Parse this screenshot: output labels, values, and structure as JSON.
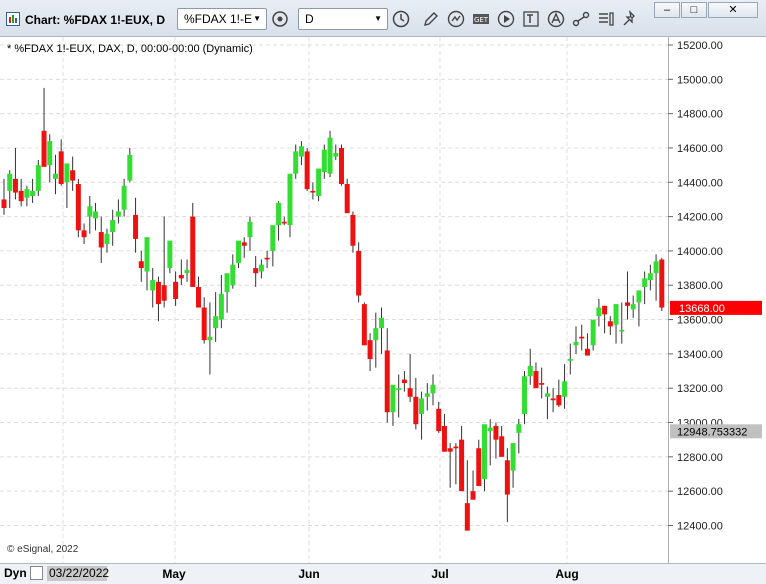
{
  "window": {
    "title": "Chart: %FDAX 1!-EUX, D"
  },
  "toolbar": {
    "symbol_value": "%FDAX 1!-E",
    "interval_value": "D",
    "icons": [
      "symbol-link-icon",
      "clock-icon",
      "pencil-icon",
      "replay-icon",
      "get-icon",
      "play-icon",
      "text-tool-icon",
      "alert-icon",
      "share-icon",
      "chart-list-icon",
      "pin-icon"
    ]
  },
  "window_controls": {
    "minimize": "–",
    "maximize": "□",
    "close": "✕"
  },
  "chart": {
    "subtitle": "* %FDAX 1!-EUX, DAX, D, 00:00-00:00 (Dynamic)",
    "credit": "© eSignal, 2022",
    "price_ticks": [
      "15200.00",
      "15000.00",
      "14800.00",
      "14600.00",
      "14400.00",
      "14200.00",
      "14000.00",
      "13800.00",
      "13600.00",
      "13400.00",
      "13200.00",
      "13000.00",
      "12800.00",
      "12600.00",
      "12400.00"
    ],
    "last_price_label": "13668.00",
    "crosshair_label": "12948.753332",
    "colors": {
      "up": "#33dd33",
      "down": "#ee1111",
      "grid": "#dcdcdc",
      "last_price_bg": "#ff0000",
      "crosshair_bg": "#c0c0c0"
    }
  },
  "bottom": {
    "mode_label": "Dyn",
    "date_value": "03/22/2022",
    "months": [
      "May",
      "Jun",
      "Jul",
      "Aug"
    ]
  },
  "chart_data": {
    "type": "candlestick",
    "ylim": [
      12250,
      15300
    ],
    "last_price": 13668,
    "crosshair_price": 12948.75,
    "candles": [
      [
        14300,
        14420,
        14210,
        14250
      ],
      [
        14350,
        14470,
        14250,
        14450
      ],
      [
        14420,
        14600,
        14300,
        14340
      ],
      [
        14350,
        14420,
        14260,
        14290
      ],
      [
        14310,
        14380,
        14260,
        14360
      ],
      [
        14320,
        14420,
        14280,
        14350
      ],
      [
        14350,
        14530,
        14320,
        14500
      ],
      [
        14700,
        14950,
        14620,
        14490
      ],
      [
        14500,
        14680,
        14400,
        14640
      ],
      [
        14420,
        14560,
        14330,
        14450
      ],
      [
        14580,
        14650,
        14380,
        14390
      ],
      [
        14400,
        14480,
        14250,
        14510
      ],
      [
        14470,
        14550,
        14350,
        14410
      ],
      [
        14390,
        14420,
        14080,
        14120
      ],
      [
        14120,
        14160,
        14040,
        14080
      ],
      [
        14200,
        14320,
        14100,
        14260
      ],
      [
        14190,
        14280,
        14120,
        14230
      ],
      [
        14110,
        14200,
        13930,
        14020
      ],
      [
        14040,
        14130,
        13990,
        14100
      ],
      [
        14110,
        14240,
        14030,
        14180
      ],
      [
        14200,
        14300,
        14160,
        14230
      ],
      [
        14240,
        14420,
        14200,
        14380
      ],
      [
        14410,
        14600,
        14400,
        14560
      ],
      [
        14210,
        14310,
        13990,
        14070
      ],
      [
        13940,
        14000,
        13820,
        13900
      ],
      [
        13880,
        14050,
        13770,
        14080
      ],
      [
        13770,
        13900,
        13670,
        13830
      ],
      [
        13820,
        13850,
        13590,
        13690
      ],
      [
        13800,
        14200,
        13670,
        13710
      ],
      [
        13900,
        14040,
        13870,
        14060
      ],
      [
        13820,
        13880,
        13680,
        13720
      ],
      [
        13860,
        13950,
        13800,
        13840
      ],
      [
        13870,
        13950,
        13820,
        13890
      ],
      [
        14200,
        14280,
        13810,
        13790
      ],
      [
        13790,
        13850,
        13690,
        13670
      ],
      [
        13670,
        13730,
        13460,
        13480
      ],
      [
        13480,
        13700,
        13280,
        13500
      ],
      [
        13550,
        13760,
        13470,
        13620
      ],
      [
        13600,
        13860,
        13550,
        13750
      ],
      [
        13760,
        13860,
        13640,
        13870
      ],
      [
        13800,
        13980,
        13780,
        13920
      ],
      [
        13930,
        14020,
        13900,
        14060
      ],
      [
        14050,
        14080,
        13960,
        14030
      ],
      [
        14080,
        14200,
        14000,
        14170
      ],
      [
        13900,
        13970,
        13790,
        13870
      ],
      [
        13880,
        13950,
        13840,
        13920
      ],
      [
        13960,
        14000,
        13900,
        13950
      ],
      [
        14000,
        14120,
        13910,
        14150
      ],
      [
        14150,
        14290,
        14060,
        14280
      ],
      [
        14170,
        14200,
        14150,
        14160
      ],
      [
        14150,
        14380,
        14080,
        14450
      ],
      [
        14450,
        14620,
        14420,
        14580
      ],
      [
        14550,
        14640,
        14500,
        14610
      ],
      [
        14580,
        14600,
        14350,
        14360
      ],
      [
        14350,
        14400,
        14300,
        14340
      ],
      [
        14320,
        14370,
        14290,
        14480
      ],
      [
        14460,
        14620,
        14420,
        14590
      ],
      [
        14450,
        14700,
        14430,
        14660
      ],
      [
        14550,
        14620,
        14530,
        14570
      ],
      [
        14600,
        14620,
        14380,
        14390
      ],
      [
        14390,
        14420,
        14250,
        14220
      ],
      [
        14210,
        14230,
        13990,
        14030
      ],
      [
        14000,
        14050,
        13700,
        13740
      ],
      [
        13690,
        13700,
        13480,
        13450
      ],
      [
        13480,
        13520,
        13300,
        13370
      ],
      [
        13480,
        13640,
        13320,
        13550
      ],
      [
        13550,
        13670,
        13400,
        13610
      ],
      [
        13420,
        13550,
        13000,
        13060
      ],
      [
        13060,
        13200,
        12980,
        13220
      ],
      [
        13190,
        13280,
        13030,
        13200
      ],
      [
        13250,
        13300,
        13180,
        13230
      ],
      [
        13200,
        13400,
        13120,
        13150
      ],
      [
        13150,
        13260,
        12960,
        12990
      ],
      [
        13050,
        13180,
        12900,
        13140
      ],
      [
        13150,
        13230,
        13070,
        13170
      ],
      [
        13170,
        13280,
        13100,
        13220
      ],
      [
        13080,
        13120,
        12940,
        12950
      ],
      [
        12980,
        13050,
        12830,
        12830
      ],
      [
        12850,
        12880,
        12620,
        12830
      ],
      [
        12860,
        12880,
        12640,
        12850
      ],
      [
        12900,
        12980,
        12650,
        12600
      ],
      [
        12530,
        12780,
        12370,
        12370
      ],
      [
        12600,
        12720,
        12590,
        12550
      ],
      [
        12850,
        12900,
        12630,
        12630
      ],
      [
        12670,
        12900,
        12600,
        12990
      ],
      [
        12950,
        13020,
        12750,
        12970
      ],
      [
        12980,
        13000,
        12790,
        12900
      ],
      [
        12920,
        12980,
        12800,
        12800
      ],
      [
        12780,
        12850,
        12420,
        12580
      ],
      [
        12720,
        12830,
        12620,
        12880
      ],
      [
        12940,
        13020,
        12820,
        12990
      ],
      [
        13050,
        13300,
        12990,
        13270
      ],
      [
        13270,
        13430,
        13220,
        13330
      ],
      [
        13300,
        13350,
        13230,
        13200
      ],
      [
        13230,
        13320,
        13140,
        13220
      ],
      [
        13150,
        13210,
        13020,
        13170
      ],
      [
        13140,
        13200,
        13060,
        13130
      ],
      [
        13160,
        13250,
        13090,
        13100
      ],
      [
        13150,
        13340,
        13080,
        13240
      ],
      [
        13360,
        13460,
        13280,
        13370
      ],
      [
        13450,
        13560,
        13400,
        13470
      ],
      [
        13500,
        13570,
        13420,
        13490
      ],
      [
        13430,
        13520,
        13400,
        13390
      ],
      [
        13450,
        13570,
        13420,
        13600
      ],
      [
        13620,
        13720,
        13560,
        13670
      ],
      [
        13680,
        13680,
        13520,
        13630
      ],
      [
        13590,
        13620,
        13510,
        13560
      ],
      [
        13570,
        13680,
        13460,
        13690
      ],
      [
        13530,
        13700,
        13460,
        13540
      ],
      [
        13700,
        13880,
        13600,
        13680
      ],
      [
        13660,
        13740,
        13610,
        13690
      ],
      [
        13700,
        13760,
        13560,
        13770
      ],
      [
        13790,
        13880,
        13690,
        13840
      ],
      [
        13830,
        13920,
        13770,
        13870
      ],
      [
        13870,
        13980,
        13710,
        13940
      ],
      [
        13950,
        13960,
        13650,
        13670
      ]
    ]
  }
}
